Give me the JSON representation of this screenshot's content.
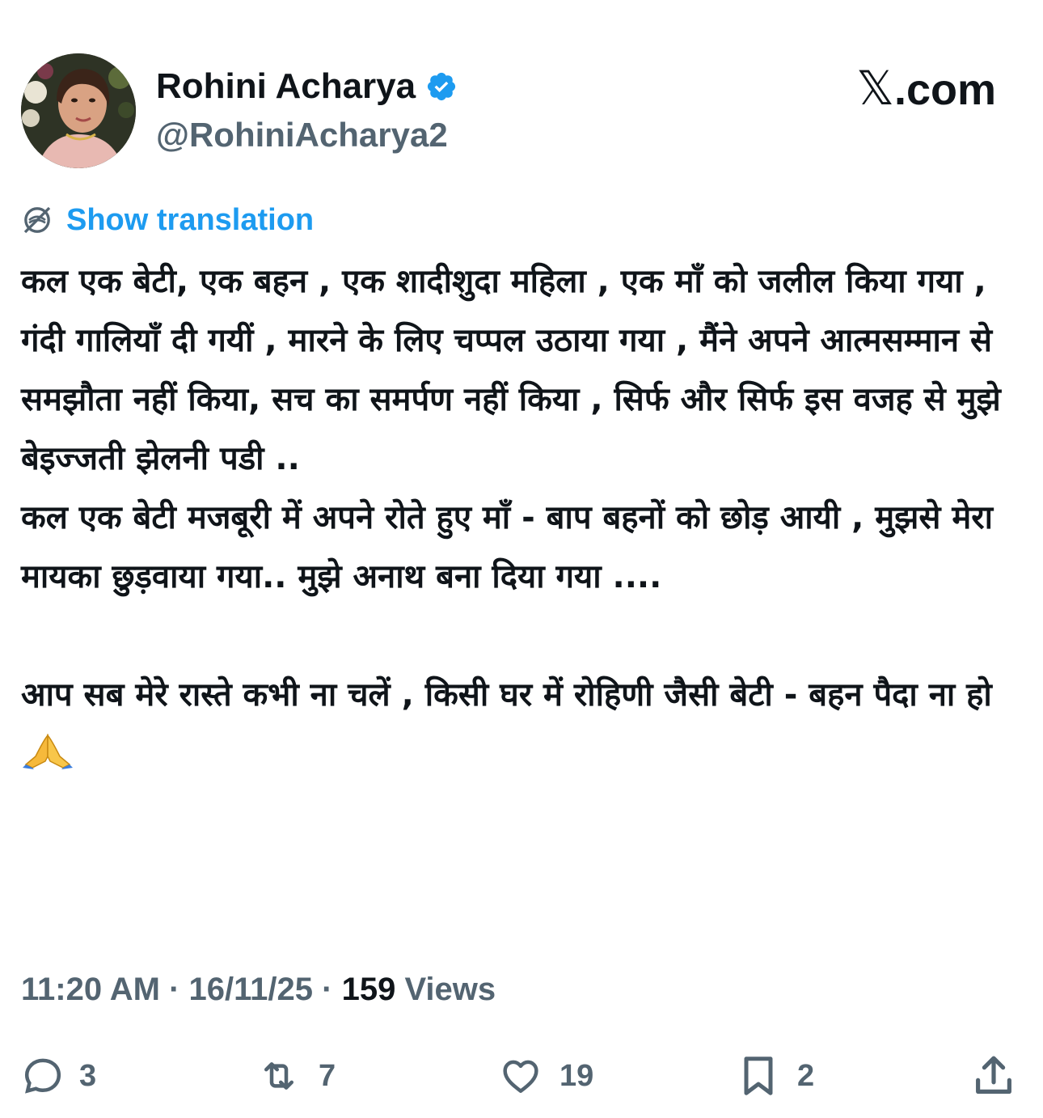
{
  "author": {
    "display_name": "Rohini Acharya",
    "handle": "@RohiniAcharya2",
    "verified": true,
    "avatar": "profile-photo"
  },
  "brand": {
    "glyph": "𝕏",
    "domain": ".com"
  },
  "translation": {
    "label": "Show translation",
    "icon": "globe-slash-icon"
  },
  "tweet": {
    "paragraphs": [
      "कल एक बेटी, एक बहन , एक शादीशुदा महिला , एक माँ को जलील किया गया , गंदी गालियाँ दी गयीं , मारने के लिए चप्पल उठाया गया , मैंने  अपने आत्मसम्मान से समझौता नहीं किया, सच का समर्पण नहीं किया , सिर्फ और सिर्फ इस वजह से मुझे बेइज्जती झेलनी पडी ..",
      "कल एक बेटी मजबूरी में अपने रोते हुए माँ - बाप बहनों को छोड़ आयी , मुझसे मेरा मायका छुड़वाया गया.. मुझे अनाथ बना दिया गया ....",
      "आप सब मेरे रास्ते कभी ना चलें , किसी घर में रोहिणी जैसी बेटी - बहन  पैदा ना  हो"
    ],
    "emoji": "folded-hands"
  },
  "meta": {
    "time": "11:20 AM",
    "separator": "·",
    "date": "16/11/25",
    "views_count": "159",
    "views_label": "Views"
  },
  "actions": {
    "replies": "3",
    "reposts": "7",
    "likes": "19",
    "bookmarks": "2"
  },
  "colors": {
    "text": "#0f1419",
    "secondary": "#536471",
    "link": "#1d9bf0",
    "verified": "#1d9bf0"
  }
}
